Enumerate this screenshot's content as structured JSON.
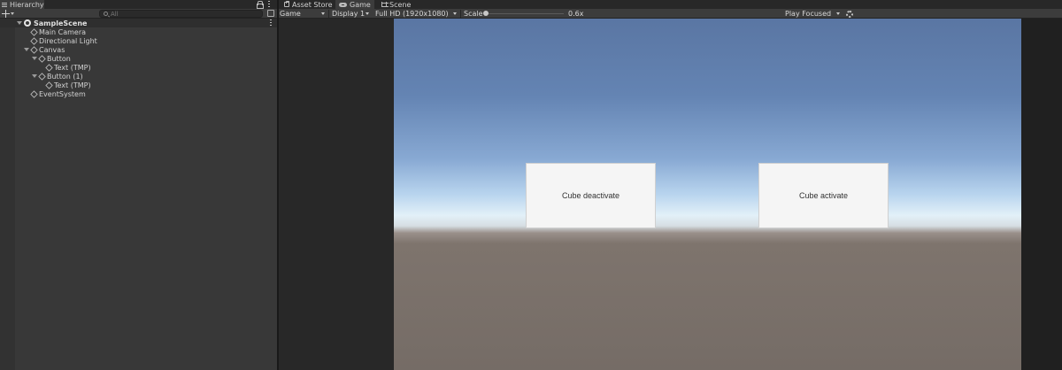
{
  "hierarchy": {
    "tab_label": "Hierarchy",
    "search_placeholder": "All",
    "items": [
      {
        "label": "SampleScene"
      },
      {
        "label": "Main Camera"
      },
      {
        "label": "Directional Light"
      },
      {
        "label": "Canvas"
      },
      {
        "label": "Button"
      },
      {
        "label": "Text (TMP)"
      },
      {
        "label": "Button (1)"
      },
      {
        "label": "Text (TMP)"
      },
      {
        "label": "EventSystem"
      }
    ]
  },
  "tabs": [
    {
      "label": "Asset Store",
      "icon": "bag-icon"
    },
    {
      "label": "Game",
      "icon": "gamepad-icon"
    },
    {
      "label": "Scene",
      "icon": "grid-icon"
    }
  ],
  "game_toolbar": {
    "view_mode": "Game",
    "display": "Display 1",
    "resolution": "Full HD (1920x1080)",
    "scale_label": "Scale",
    "scale_value": "0.6x",
    "play_mode": "Play Focused"
  },
  "game_view": {
    "buttons": [
      {
        "label": "Cube deactivate"
      },
      {
        "label": "Cube activate"
      }
    ]
  },
  "colors": {
    "panel": "#383838",
    "toolbar": "#3c3c3c",
    "sky_top": "#5a76a3",
    "ground": "#756c66",
    "button_bg": "#f5f5f5"
  }
}
